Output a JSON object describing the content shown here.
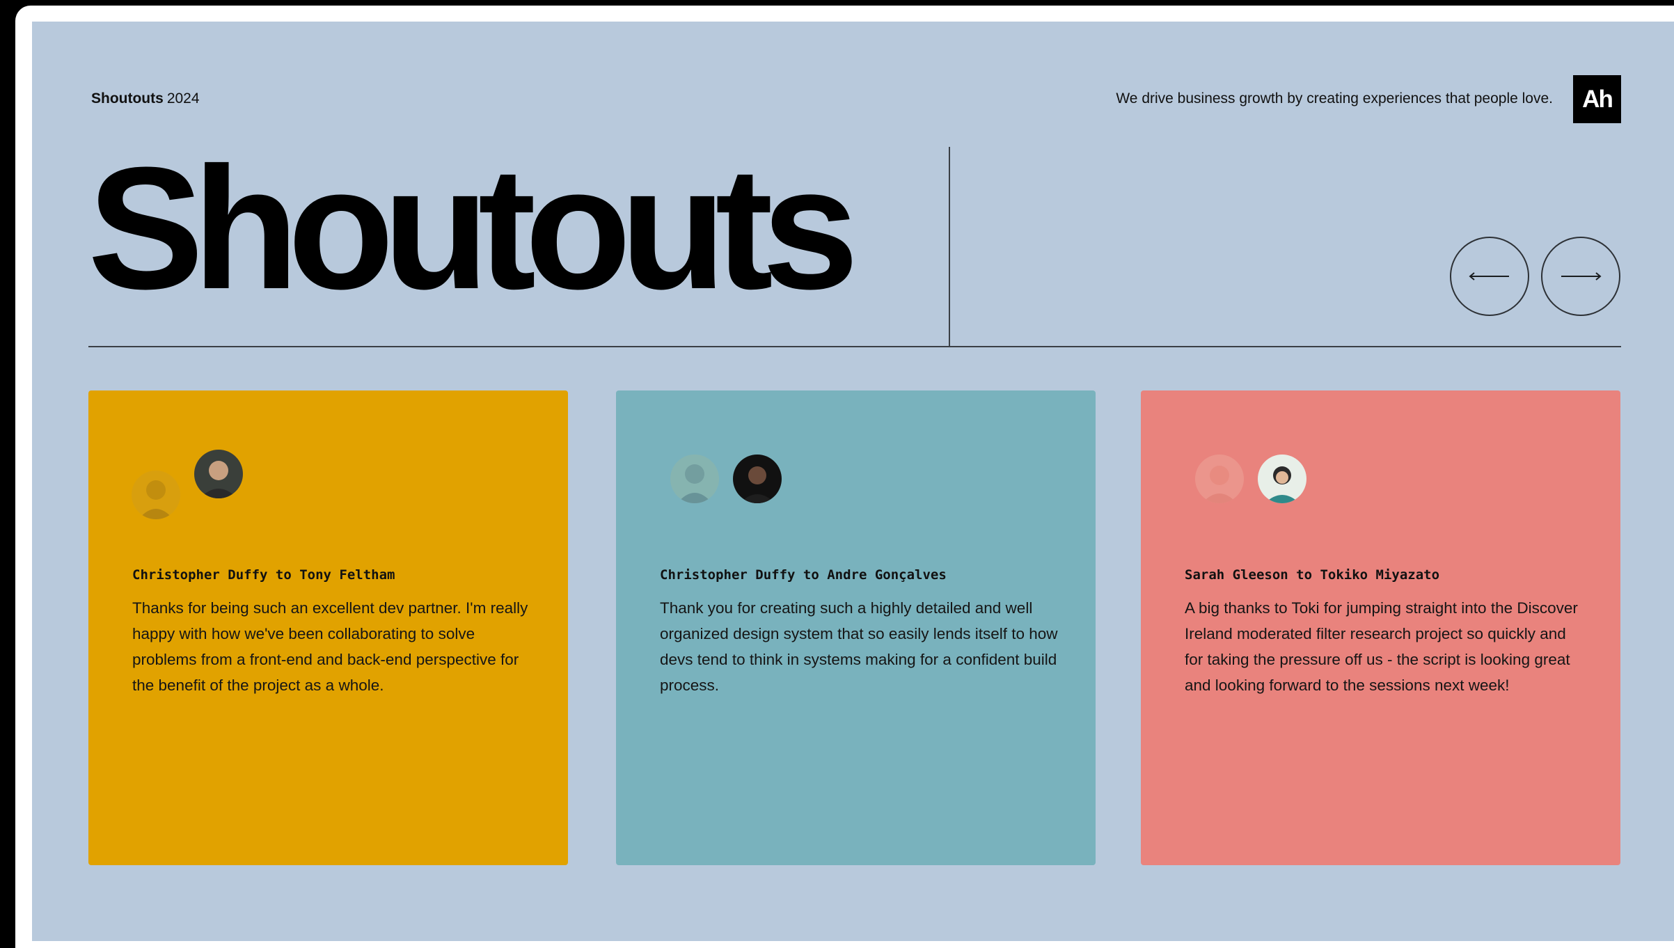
{
  "header": {
    "title_bold": "Shoutouts",
    "title_year": "2024",
    "tagline": "We drive business growth by creating experiences that people love.",
    "logo_text": "Ah"
  },
  "hero": {
    "title": "Shoutouts"
  },
  "navigation": {
    "prev_icon": "arrow-left-icon",
    "next_icon": "arrow-right-icon"
  },
  "colors": {
    "background": "#b8c9dc",
    "card_1": "#e1a200",
    "card_2": "#79b2bd",
    "card_3": "#e9837d"
  },
  "cards": [
    {
      "from_to": "Christopher Duffy to Tony Feltham",
      "message": "Thanks for being such an excellent dev partner. I'm really happy with how we've been collaborating to solve problems from a front-end and back-end perspective for the benefit of the project as a whole.",
      "from_avatar": "avatar-christopher-duffy",
      "to_avatar": "avatar-tony-feltham"
    },
    {
      "from_to": "Christopher Duffy to Andre Gonçalves",
      "message": "Thank you for creating such a highly detailed and well organized design system that so easily lends itself to how devs tend to think in systems making for a confident build process.",
      "from_avatar": "avatar-christopher-duffy",
      "to_avatar": "avatar-andre-goncalves"
    },
    {
      "from_to": "Sarah Gleeson to Tokiko Miyazato",
      "message": "A big thanks to Toki for jumping straight into the Discover Ireland moderated filter research project so quickly and for taking the pressure off us - the script is looking great and looking forward to the sessions next week!",
      "from_avatar": "avatar-sarah-gleeson",
      "to_avatar": "avatar-tokiko-miyazato"
    }
  ]
}
